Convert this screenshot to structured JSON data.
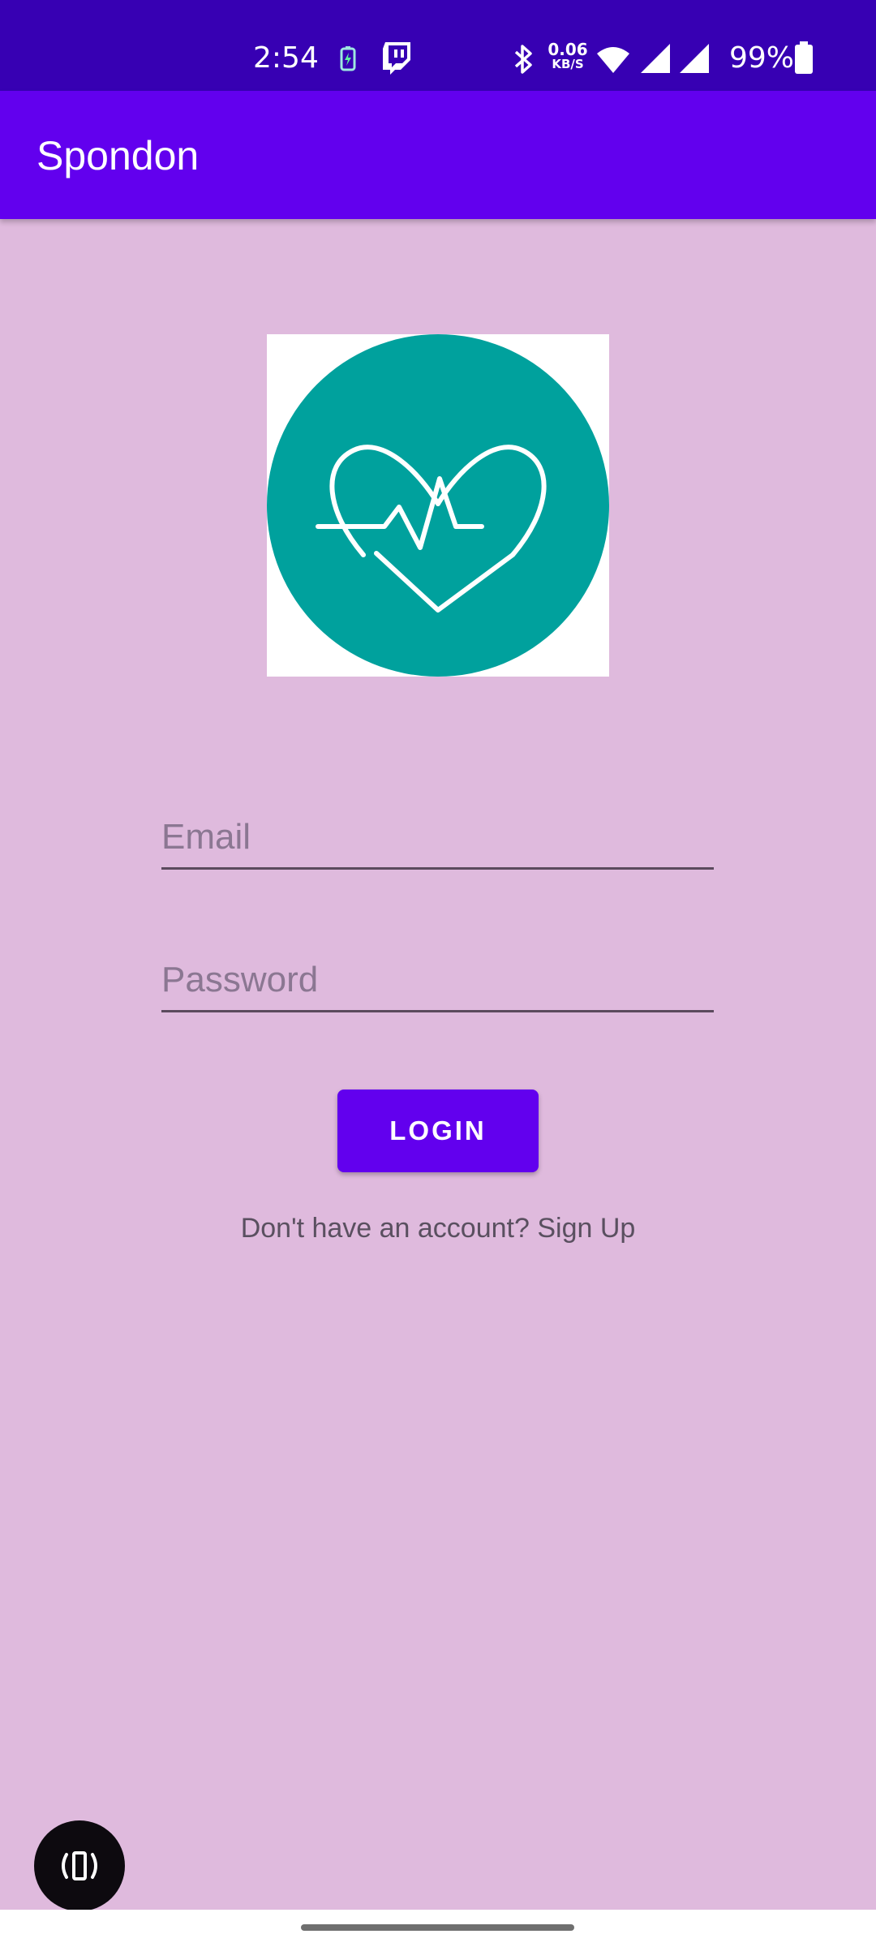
{
  "status_bar": {
    "time": "2:54",
    "net_speed_value": "0.06",
    "net_speed_unit": "KB/S",
    "battery_percent": "99%",
    "icons": [
      "battery-saver-icon",
      "twitch-icon",
      "bluetooth-icon",
      "wifi-icon",
      "signal-icon",
      "signal-icon",
      "battery-icon"
    ]
  },
  "app_bar": {
    "title": "Spondon"
  },
  "logo": {
    "icon": "heart-pulse-icon",
    "circle_color": "#00a19d"
  },
  "form": {
    "email_placeholder": "Email",
    "email_value": "",
    "password_placeholder": "Password",
    "password_value": "",
    "login_label": "LOGIN",
    "signup_text": "Don't have an account? Sign Up"
  },
  "colors": {
    "status_bar": "#3700b3",
    "app_bar": "#6200ee",
    "background": "#dfbadd",
    "button": "#6200ee"
  }
}
